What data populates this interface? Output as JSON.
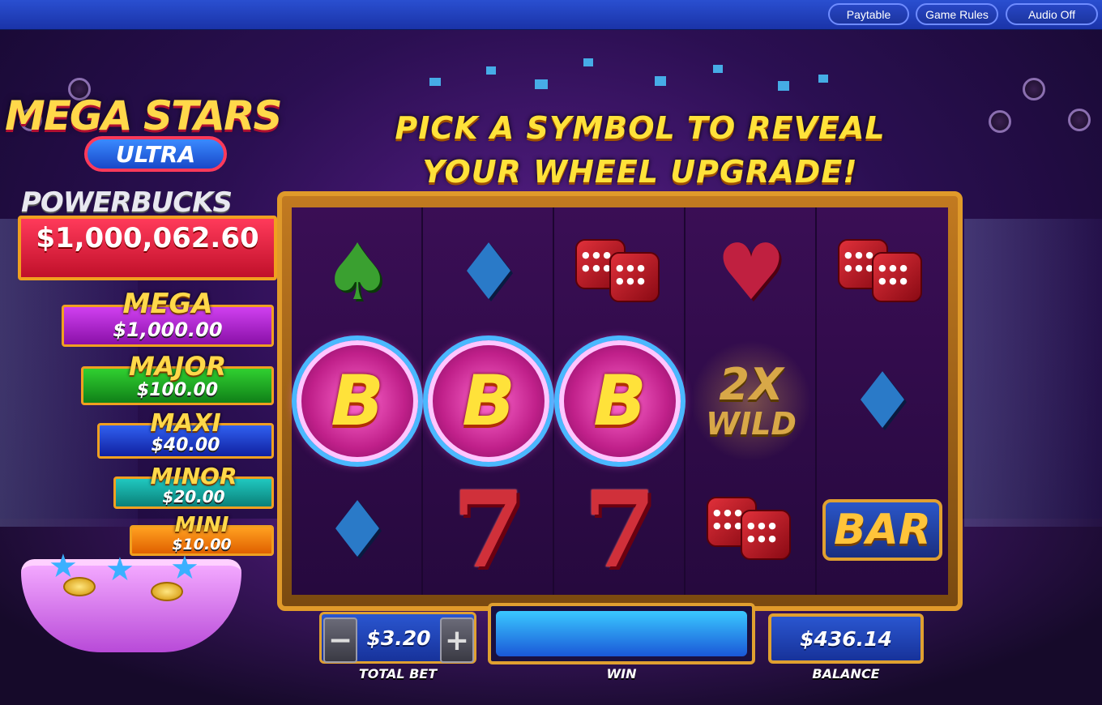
{
  "topbar": {
    "paytable_label": "Paytable",
    "game_rules_label": "Game Rules",
    "audio_label": "Audio Off"
  },
  "logo": {
    "title": "MEGA STARS",
    "subtitle": "ULTRA"
  },
  "powerbucks": {
    "label": "POWERBUCKS",
    "value": "$1,000,062.60"
  },
  "jackpots": [
    {
      "name": "MEGA",
      "value": "$1,000.00",
      "color": "#c022d8"
    },
    {
      "name": "MAJOR",
      "value": "$100.00",
      "color": "#1aa820"
    },
    {
      "name": "MAXI",
      "value": "$40.00",
      "color": "#1838d0"
    },
    {
      "name": "MINOR",
      "value": "$20.00",
      "color": "#10a8a0"
    },
    {
      "name": "MINI",
      "value": "$10.00",
      "color": "#f08010"
    }
  ],
  "headline": {
    "line1": "PICK A SYMBOL TO REVEAL",
    "line2": "YOUR WHEEL UPGRADE!"
  },
  "reels": [
    [
      "spade-icon",
      "bonus-b",
      "diamond-icon"
    ],
    [
      "diamond-icon",
      "bonus-b",
      "seven"
    ],
    [
      "dice-icon",
      "bonus-b",
      "seven"
    ],
    [
      "heart-icon",
      "wild-2x",
      "dice-icon"
    ],
    [
      "dice-icon",
      "diamond-icon",
      "bar"
    ]
  ],
  "symbols": {
    "bonus_letter": "B",
    "wild_top": "2X",
    "wild_bottom": "WILD",
    "bar_text": "BAR",
    "seven_text": "7"
  },
  "controls": {
    "minus": "−",
    "plus": "+",
    "total_bet_value": "$3.20",
    "total_bet_label": "TOTAL BET",
    "win_value": "",
    "win_label": "WIN",
    "balance_value": "$436.14",
    "balance_label": "BALANCE"
  }
}
